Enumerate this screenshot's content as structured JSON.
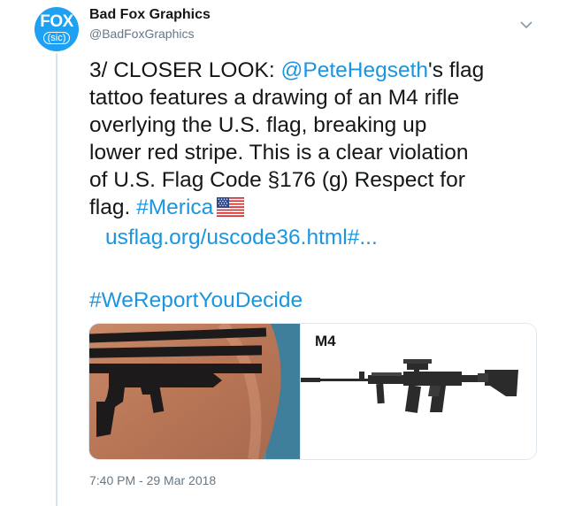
{
  "author": {
    "display_name": "Bad Fox Graphics",
    "handle": "@BadFoxGraphics",
    "avatar_text": "FOX",
    "avatar_subtext": "(sic)"
  },
  "tweet": {
    "line1_prefix": "3/ CLOSER LOOK: ",
    "mention": "@PeteHegseth",
    "line1_suffix": "'s flag",
    "line2": "tattoo features a drawing of an M4 rifle",
    "line3": "overlying the U.S. flag, breaking up",
    "line4": "lower red stripe. This is a clear violation",
    "line5": "of U.S. Flag Code §176 (g) Respect for",
    "line6_prefix": "flag.  ",
    "hashtag_merica": "#Merica",
    "flag_emoji": "us-flag-emoji",
    "url": "usflag.org/uscode36.html#...",
    "hashtag_bottom": "#WeReportYouDecide"
  },
  "media": {
    "right_label": "M4",
    "left_image": "tattoo-photo",
    "right_image": "m4-rifle-photo"
  },
  "timestamp": "7:40 PM - 29 Mar 2018",
  "colors": {
    "link": "#1b95e0",
    "avatar": "#1ea1f2",
    "muted": "#657786",
    "thread": "#d6e3ec"
  },
  "icons": {
    "caret": "chevron-down-icon"
  }
}
